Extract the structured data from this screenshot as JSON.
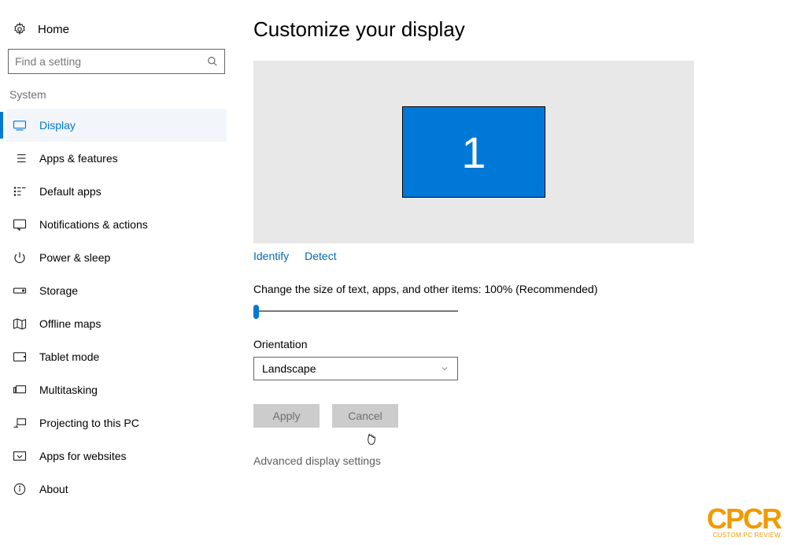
{
  "home_label": "Home",
  "search": {
    "placeholder": "Find a setting"
  },
  "category": "System",
  "nav": [
    {
      "label": "Display",
      "active": true
    },
    {
      "label": "Apps & features"
    },
    {
      "label": "Default apps"
    },
    {
      "label": "Notifications & actions"
    },
    {
      "label": "Power & sleep"
    },
    {
      "label": "Storage"
    },
    {
      "label": "Offline maps"
    },
    {
      "label": "Tablet mode"
    },
    {
      "label": "Multitasking"
    },
    {
      "label": "Projecting to this PC"
    },
    {
      "label": "Apps for websites"
    },
    {
      "label": "About"
    }
  ],
  "title": "Customize your display",
  "monitor_number": "1",
  "identify": "Identify",
  "detect": "Detect",
  "scale_label": "Change the size of text, apps, and other items: 100% (Recommended)",
  "orientation_label": "Orientation",
  "orientation_value": "Landscape",
  "apply": "Apply",
  "cancel": "Cancel",
  "advanced": "Advanced display settings",
  "watermark_main": "CPCR",
  "watermark_sub": "CUSTOM PC REVIEW"
}
